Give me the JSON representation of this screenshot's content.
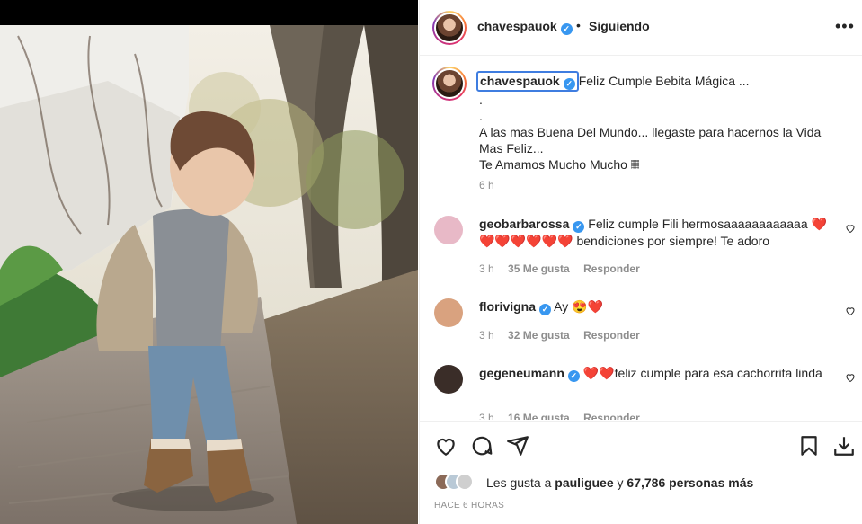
{
  "post": {
    "username": "chavespauok",
    "separator": "•",
    "follow_status": "Siguiendo",
    "more_glyph": "•••",
    "verified_glyph": "✓"
  },
  "caption": {
    "username": "chavespauok",
    "title": "Feliz Cumple Bebita Mágica ...",
    "line_dot1": ".",
    "line_dot2": ".",
    "line1": "A las mas Buena Del Mundo... llegaste para hacernos la Vida Mas Feliz...",
    "line2": "Te Amamos Mucho Mucho 𝄜",
    "time": "6 h"
  },
  "comments": [
    {
      "username": "geobarbarossa",
      "text": "Feliz cumple Fili hermosaaaaaaaaaaaa ❤️ ❤️❤️❤️❤️❤️❤️ bendiciones por siempre! Te adoro",
      "time": "3 h",
      "likes": "35 Me gusta",
      "reply": "Responder",
      "avatar_color": "#e8b9c7"
    },
    {
      "username": "florivigna",
      "text": "Ay 😍❤️",
      "time": "3 h",
      "likes": "32 Me gusta",
      "reply": "Responder",
      "avatar_color": "#d9a27f"
    },
    {
      "username": "gegeneumann",
      "text": "❤️❤️feliz cumple para esa cachorrita linda",
      "time": "3 h",
      "likes": "16 Me gusta",
      "reply": "Responder",
      "avatar_color": "#3a2d28"
    }
  ],
  "footer": {
    "likes_prefix": "Les gusta a ",
    "liker": "pauliguee",
    "likes_mid": " y ",
    "likes_count": "67,786 personas más",
    "posted_ago": "HACE 6 HORAS"
  },
  "icons": {
    "like": "heart-icon",
    "comment": "comment-icon",
    "share": "share-icon",
    "save": "bookmark-icon",
    "download": "download-icon",
    "more": "more-options-icon",
    "verified": "verified-badge-icon"
  },
  "colors": {
    "accent_blue": "#3897f0",
    "muted_text": "#8e8e8e",
    "story_ring": "#e1306c"
  }
}
